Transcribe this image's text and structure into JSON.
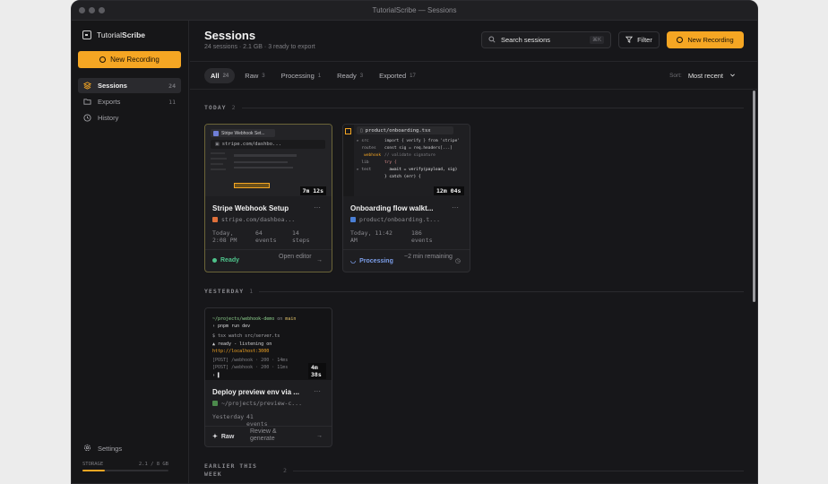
{
  "window": {
    "title": "TutorialScribe — Sessions"
  },
  "brand": {
    "name_regular": "Tutorial",
    "name_bold": "Scribe"
  },
  "sidebar": {
    "new_recording": "New Recording",
    "items": [
      {
        "label": "Sessions",
        "count": "24"
      },
      {
        "label": "Exports",
        "count": "11"
      },
      {
        "label": "History",
        "count": ""
      }
    ],
    "settings": "Settings",
    "storage_label": "STORAGE",
    "storage_value": "2.1 / 8 GB",
    "storage_fraction": 0.26
  },
  "header": {
    "title": "Sessions",
    "subtitle": "24 sessions · 2.1 GB · 3 ready to export",
    "search_placeholder": "Search sessions",
    "search_kbd": "⌘K",
    "filter": "Filter",
    "new_recording": "New Recording"
  },
  "tabs": [
    {
      "label": "All",
      "count": "24"
    },
    {
      "label": "Raw",
      "count": "3"
    },
    {
      "label": "Processing",
      "count": "1"
    },
    {
      "label": "Ready",
      "count": "3"
    },
    {
      "label": "Exported",
      "count": "17"
    }
  ],
  "sort": {
    "label": "Sort:",
    "value": "Most recent"
  },
  "sections": [
    {
      "label": "TODAY",
      "count": "2"
    },
    {
      "label": "YESTERDAY",
      "count": "1"
    },
    {
      "label": "EARLIER THIS WEEK",
      "count": "2"
    }
  ],
  "cards": [
    {
      "tab_title": "Stripe Webhook Set...",
      "tab_url": "stripe.com/dashbo...",
      "duration": "7m 12s",
      "title": "Stripe Webhook Setup",
      "source": "stripe.com/dashboa...",
      "date": "Today, 2:08 PM",
      "events": "64 events",
      "steps": "14 steps",
      "status": "Ready",
      "action": "Open editor"
    },
    {
      "tab_title": "product/onboarding.tsx",
      "duration": "12m 04s",
      "title": "Onboarding flow walkt...",
      "source": "product/onboarding.t...",
      "date": "Today, 11:42 AM",
      "events": "186 events",
      "status": "Processing",
      "action": "~2 min remaining",
      "code_lines": [
        "import { verify } from 'stripe'",
        "const sig = req.headers[...]",
        "// validate signature",
        "try {",
        "  await = verify(payload, sig)",
        "} catch (err) {"
      ],
      "tree": [
        "src",
        "routes",
        "webhook",
        "lib",
        "test"
      ]
    },
    {
      "duration": "4m 38s",
      "title": "Deploy preview env via ...",
      "source": "~/projects/preview-c...",
      "date": "Yesterday",
      "events": "41 events",
      "status": "Raw",
      "action": "Review & generate",
      "term_path": "~/projects/webhook-demo",
      "term_branch": "main",
      "term_lines": [
        "› pnpm run dev",
        "$ tsx watch src/server.ts",
        "▲ ready - listening on",
        "http://localhost:3000",
        "[POST] /webhook · 200 · 14ms",
        "[POST] /webhook · 200 · 11ms",
        "› ▌"
      ]
    }
  ]
}
